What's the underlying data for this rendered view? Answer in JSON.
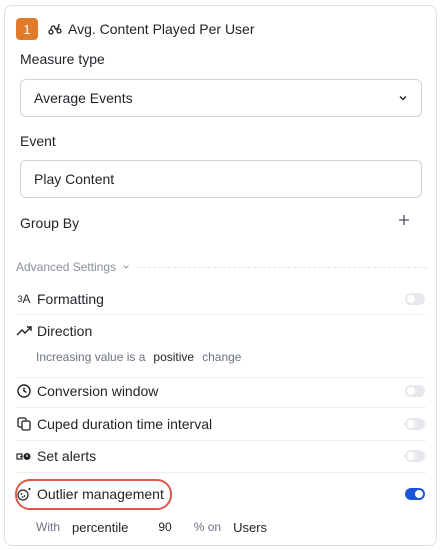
{
  "metric": {
    "index": "1",
    "title": "Avg. Content Played Per User",
    "badge_color": "#e07b2a",
    "icon": "sparkline-icon"
  },
  "measure_type": {
    "label": "Measure type",
    "value": "Average Events"
  },
  "event": {
    "label": "Event",
    "value": "Play Content"
  },
  "group_by": {
    "label": "Group By"
  },
  "advanced": {
    "label": "Advanced Settings",
    "formatting": {
      "label": "Formatting",
      "enabled": false
    },
    "direction": {
      "label": "Direction",
      "prefix": "Increasing value is a",
      "value": "positive",
      "suffix": "change"
    },
    "conversion_window": {
      "label": "Conversion window",
      "enabled": false
    },
    "cuped": {
      "label": "Cuped duration time interval",
      "enabled": false
    },
    "alerts": {
      "label": "Set alerts",
      "enabled": false
    },
    "outlier": {
      "label": "Outlier management",
      "enabled": true,
      "with_label": "With",
      "method": "percentile",
      "percent": "90",
      "on_label": "% on",
      "target": "Users"
    }
  },
  "colors": {
    "accent": "#1a56db",
    "highlight": "#e0574c"
  }
}
